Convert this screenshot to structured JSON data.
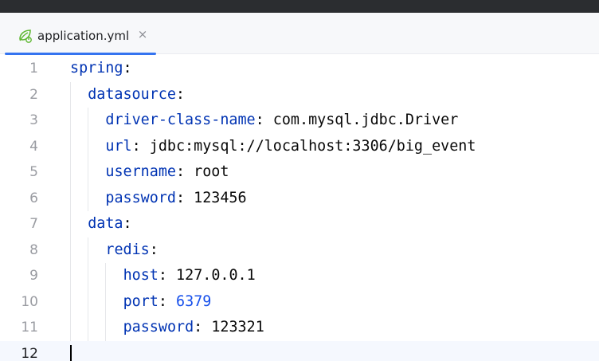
{
  "tab": {
    "label": "application.yml",
    "close_glyph": "×",
    "icon": "spring-leaf-icon"
  },
  "colors": {
    "key": "#0033b3",
    "number": "#1750eb",
    "tab_accent": "#3574f0"
  },
  "lines": [
    {
      "n": "1",
      "indent": 0,
      "key": "spring",
      "sep": ":",
      "value": "",
      "value_type": "none"
    },
    {
      "n": "2",
      "indent": 1,
      "key": "datasource",
      "sep": ":",
      "value": "",
      "value_type": "none"
    },
    {
      "n": "3",
      "indent": 2,
      "key": "driver-class-name",
      "sep": ": ",
      "value": "com.mysql.jdbc.Driver",
      "value_type": "string"
    },
    {
      "n": "4",
      "indent": 2,
      "key": "url",
      "sep": ": ",
      "value": "jdbc:mysql://localhost:3306/big_event",
      "value_type": "string"
    },
    {
      "n": "5",
      "indent": 2,
      "key": "username",
      "sep": ": ",
      "value": "root",
      "value_type": "string"
    },
    {
      "n": "6",
      "indent": 2,
      "key": "password",
      "sep": ": ",
      "value": "123456",
      "value_type": "string"
    },
    {
      "n": "7",
      "indent": 1,
      "key": "data",
      "sep": ":",
      "value": "",
      "value_type": "none"
    },
    {
      "n": "8",
      "indent": 2,
      "key": "redis",
      "sep": ":",
      "value": "",
      "value_type": "none"
    },
    {
      "n": "9",
      "indent": 3,
      "key": "host",
      "sep": ": ",
      "value": "127.0.0.1",
      "value_type": "string"
    },
    {
      "n": "10",
      "indent": 3,
      "key": "port",
      "sep": ": ",
      "value": "6379",
      "value_type": "number"
    },
    {
      "n": "11",
      "indent": 3,
      "key": "password",
      "sep": ": ",
      "value": "123321",
      "value_type": "string"
    },
    {
      "n": "12",
      "indent": 0,
      "key": "",
      "sep": "",
      "value": "",
      "value_type": "none",
      "current": true
    }
  ]
}
